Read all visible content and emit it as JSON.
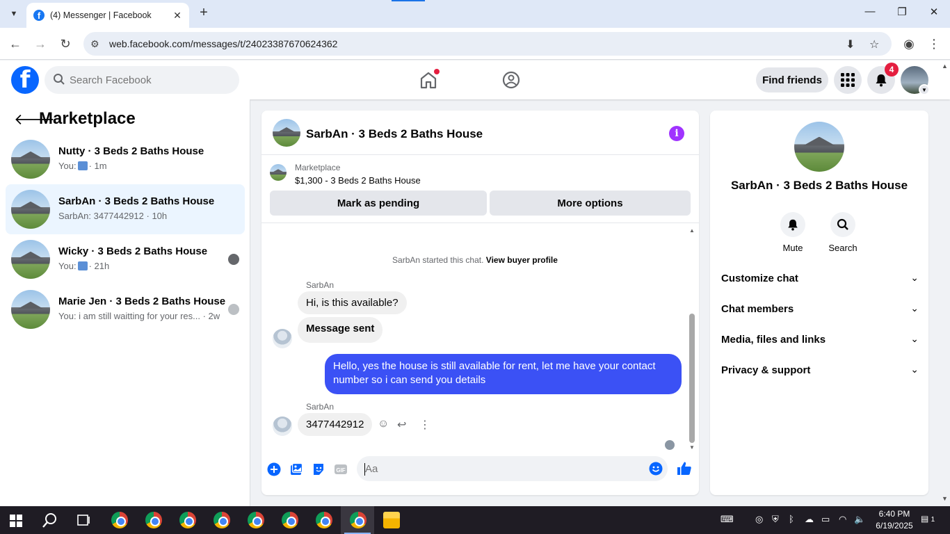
{
  "browser": {
    "tab_title": "(4) Messenger | Facebook",
    "url": "web.facebook.com/messages/t/24023387670624362"
  },
  "fb": {
    "search_placeholder": "Search Facebook",
    "find_friends": "Find friends",
    "notification_count": "4",
    "brand_color": "#0866ff"
  },
  "left": {
    "title": "Marketplace",
    "conversations": [
      {
        "name": "Nutty · 3 Beds 2 Baths House",
        "preview_prefix": "You:",
        "preview_text": "",
        "time": "· 1m",
        "has_like": true
      },
      {
        "name": "SarbAn · 3 Beds 2 Baths House",
        "preview_prefix": "SarbAn: 3477442912",
        "preview_text": "",
        "time": "· 10h",
        "has_like": false
      },
      {
        "name": "Wicky · 3 Beds 2 Baths House",
        "preview_prefix": "You:",
        "preview_text": "",
        "time": "· 21h",
        "has_like": true
      },
      {
        "name": "Marie Jen · 3 Beds 2 Baths House",
        "preview_prefix": "You: i am still waitting for your res...",
        "preview_text": "",
        "time": " · 2w",
        "has_like": false
      }
    ]
  },
  "chat": {
    "title": "SarbAn · 3 Beds 2 Baths House",
    "listing_label": "Marketplace",
    "listing_price": "$1,300 - 3 Beds 2 Baths House",
    "mark_pending": "Mark as pending",
    "more_options": "More options",
    "started_text": "SarbAn started this chat.",
    "view_buyer": "View buyer profile",
    "messages": [
      {
        "sender": "SarbAn",
        "text": "Hi, is this available?"
      },
      {
        "text": "Message sent"
      },
      {
        "text": "Hello, yes the house is still available for rent, let me have your contact number so i can send you  details"
      },
      {
        "sender": "SarbAn",
        "text": "3477442912"
      }
    ],
    "composer_placeholder": "Aa",
    "accent": "#3b51f5"
  },
  "right": {
    "name": "SarbAn · 3 Beds 2 Baths House",
    "mute": "Mute",
    "search": "Search",
    "sections": [
      "Customize chat",
      "Chat members",
      "Media, files and links",
      "Privacy & support"
    ]
  },
  "taskbar": {
    "time": "6:40 PM",
    "date": "6/19/2025",
    "notif": "1"
  }
}
